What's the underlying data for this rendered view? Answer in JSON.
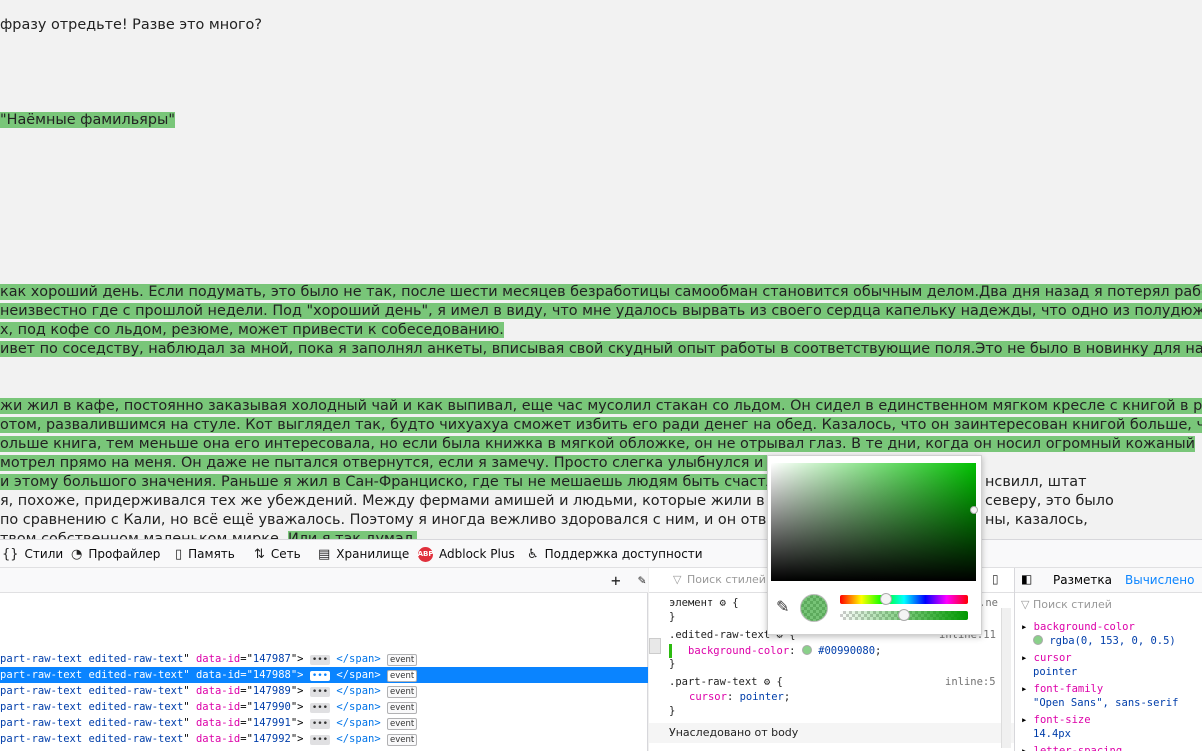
{
  "content": {
    "lines": [
      {
        "text": "фразу отредьте! Разве это много?",
        "hl": false
      },
      {
        "text": " \"Наёмные фамильяры\"",
        "hl": true
      },
      {
        "text": "как хороший день. Если подумать, это было не так, после шести месяцев безработицы самообман становится обычным делом.Два дня назад я потерял работу, и",
        "hl": true
      },
      {
        "text": "неизвестно где с прошлой недели. Под \"хороший день\", я имел в виду, что мне удалось вырвать из своего сердца капельку надежды, что одно из полудюжины",
        "hl": true
      },
      {
        "text": "х, под кофе со льдом, резюме, может привести к собеседованию.",
        "hl": true
      },
      {
        "text": "ивет по соседству, наблюдал за мной, пока я заполнял анкеты, вписывая свой скудный опыт работы в соответствующие поля.Это не было в новинку для нас",
        "hl": true
      },
      {
        "text": "жи жил в кафе, постоянно заказывая холодный чай и как выпивал, еще час мусолил стакан со льдом. Он сидел в единственном мягком кресле с книгой в руках и",
        "hl": true
      },
      {
        "text": "отом, развалившимся на стуле. Кот выглядел так, будто чихуахуа сможет избить его ради денег на обед. Казалось, что он заинтересован книгой больше, чем",
        "hl": true
      },
      {
        "text": "ольше книга, тем меньше она его интересовала, но если была книжка в мягкой обложке, он не отрывал глаз. В те дни, когда он носил огромный кожаный",
        "hl": true
      },
      {
        "text": "мотрел прямо на меня. Он даже не пытался отвернутся, если я замечу. Просто слегка улыбнулся и кивнул мне",
        "hl": true
      },
      {
        "text": "и этому большого значения. Раньше я жил в Сан-Франциско, где ты не мешаешь людям быть счастливыми, не",
        "hl": true
      },
      {
        "text": "я, похоже, придерживался тех же убеждений. Между фермами амишей и людьми, которые жили в национально",
        "hl": false
      },
      {
        "text": "по сравнению с Кали, но всё ещё уважалось. Поэтому я иногда вежливо здоровался с ним, и он отвечал мне",
        "hl": false
      },
      {
        "text": "твом собственном маленьком мирке. ",
        "hl": false
      }
    ],
    "tail_right": [
      {
        "text": "нсвилл, штат"
      },
      {
        "text": "севeру, это было"
      },
      {
        "text": "ны, казалось,"
      }
    ],
    "last_hl": "Или я так думал."
  },
  "toolbar": {
    "tabs": [
      {
        "label": "Стили",
        "icon": "braces-icon"
      },
      {
        "label": "Профайлер",
        "icon": "gauge-icon"
      },
      {
        "label": "Память",
        "icon": "chip-icon"
      },
      {
        "label": "Сеть",
        "icon": "arrows-icon"
      },
      {
        "label": "Хранилище",
        "icon": "storage-icon"
      },
      {
        "label": "Adblock Plus",
        "icon": "abp-icon"
      },
      {
        "label": "Поддержка доступности",
        "icon": "accessibility-icon"
      }
    ],
    "abp_text": "ABP"
  },
  "markup": {
    "rows": [
      {
        "cls": "part-raw-text edited-raw-text",
        "id": "147987",
        "selected": false
      },
      {
        "cls": "part-raw-text edited-raw-text",
        "id": "147988",
        "selected": true
      },
      {
        "cls": "part-raw-text edited-raw-text",
        "id": "147989",
        "selected": false
      },
      {
        "cls": "part-raw-text edited-raw-text",
        "id": "147990",
        "selected": false
      },
      {
        "cls": "part-raw-text edited-raw-text",
        "id": "147991",
        "selected": false
      },
      {
        "cls": "part-raw-text edited-raw-text",
        "id": "147992",
        "selected": false
      }
    ],
    "attr_name": "data-id",
    "dots": "•••",
    "close_tag": "</span>",
    "event_label": "event"
  },
  "rules": {
    "filter_placeholder": "Поиск стилей",
    "element_rule": "элемент",
    "rule1_selector": ".edited-raw-text",
    "rule1_source": "inline:11",
    "rule1_prop": "background-color",
    "rule1_value": "#00990080",
    "rule2_selector": ".part-raw-text",
    "rule2_source": "inline:5",
    "rule2_prop": "cursor",
    "rule2_value": "pointer",
    "inherited_label": "Унаследовано от body",
    "open_brace": "{",
    "close_brace": "}",
    "ne_text": ".ne"
  },
  "computed": {
    "tabs": [
      "Разметка",
      "Вычислено"
    ],
    "filter_placeholder": "Поиск стилей",
    "props": [
      {
        "name": "background-color",
        "value": "rgba(0, 153, 0, 0.5)",
        "swatch": true
      },
      {
        "name": "cursor",
        "value": "pointer",
        "swatch": false
      },
      {
        "name": "font-family",
        "value": "\"Open Sans\", sans-serif",
        "swatch": false
      },
      {
        "name": "font-size",
        "value": "14.4px",
        "swatch": false
      },
      {
        "name": "letter-spacing",
        "value": "",
        "swatch": false
      }
    ]
  },
  "colors": {
    "highlight": "#00990080",
    "selection": "#0a84ff"
  }
}
